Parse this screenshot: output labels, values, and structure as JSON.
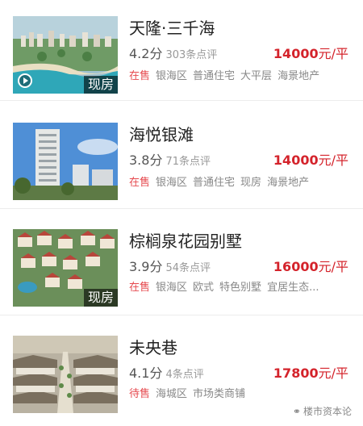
{
  "listings": [
    {
      "name": "天隆·三千海",
      "score": "4.2分",
      "reviews": "303条点评",
      "price": "14000",
      "unit": "元/平",
      "thumb_tag": "现房",
      "has_video": true,
      "tags": [
        "在售",
        "银海区",
        "普通住宅",
        "大平层",
        "海景地产"
      ]
    },
    {
      "name": "海悦银滩",
      "score": "3.8分",
      "reviews": "71条点评",
      "price": "14000",
      "unit": "元/平",
      "thumb_tag": "",
      "has_video": false,
      "tags": [
        "在售",
        "银海区",
        "普通住宅",
        "现房",
        "海景地产"
      ]
    },
    {
      "name": "棕榈泉花园别墅",
      "score": "3.9分",
      "reviews": "54条点评",
      "price": "16000",
      "unit": "元/平",
      "thumb_tag": "现房",
      "has_video": false,
      "tags": [
        "在售",
        "银海区",
        "欧式",
        "特色别墅",
        "宜居生态..."
      ]
    },
    {
      "name": "未央巷",
      "score": "4.1分",
      "reviews": "4条点评",
      "price": "17800",
      "unit": "元/平",
      "thumb_tag": "",
      "has_video": false,
      "tags": [
        "待售",
        "海城区",
        "市场类商铺"
      ]
    }
  ],
  "watermark": "楼市资本论",
  "colors": {
    "price": "#d4232b",
    "status": "#e64a4f"
  }
}
